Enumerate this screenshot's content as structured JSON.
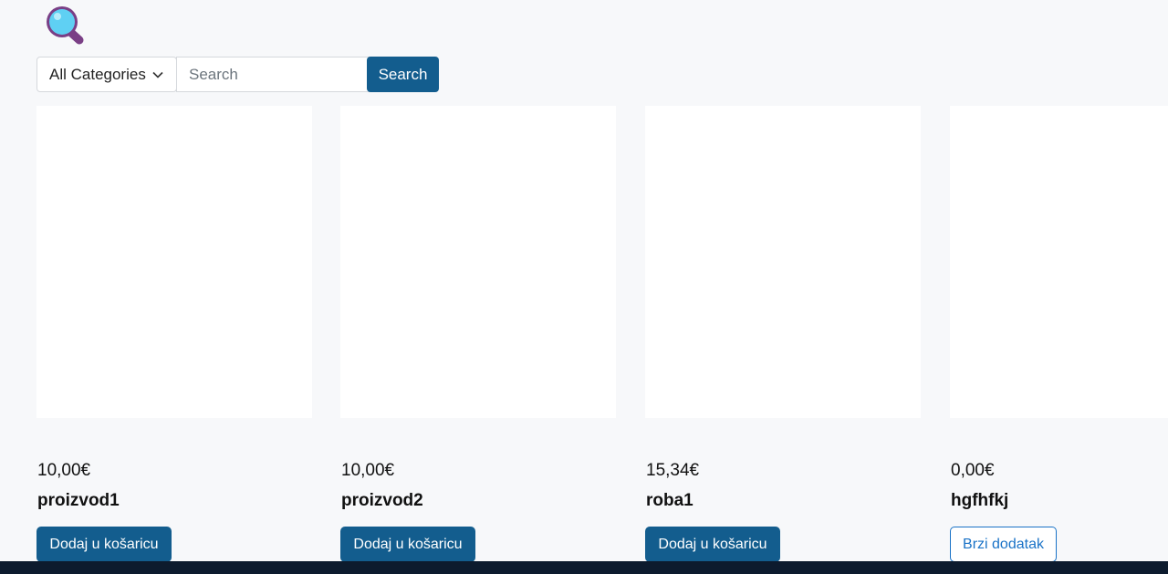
{
  "header": {
    "logo_icon": "magnifying-glass-icon"
  },
  "search": {
    "category_selected": "All Categories",
    "placeholder": "Search",
    "value": "",
    "button_label": "Search"
  },
  "products": [
    {
      "price": "10,00€",
      "name": "proizvod1",
      "action_label": "Dodaj u košaricu"
    },
    {
      "price": "10,00€",
      "name": "proizvod2",
      "action_label": "Dodaj u košaricu"
    },
    {
      "price": "15,34€",
      "name": "roba1",
      "action_label": "Dodaj u košaricu"
    },
    {
      "price": "0,00€",
      "name": "hgfhfkj",
      "action_label": "Brzi dodatak"
    }
  ],
  "colors": {
    "primary": "#135d8e",
    "outline": "#1a73c7",
    "background": "#f7f8fa",
    "footer": "#0d1b2e"
  }
}
